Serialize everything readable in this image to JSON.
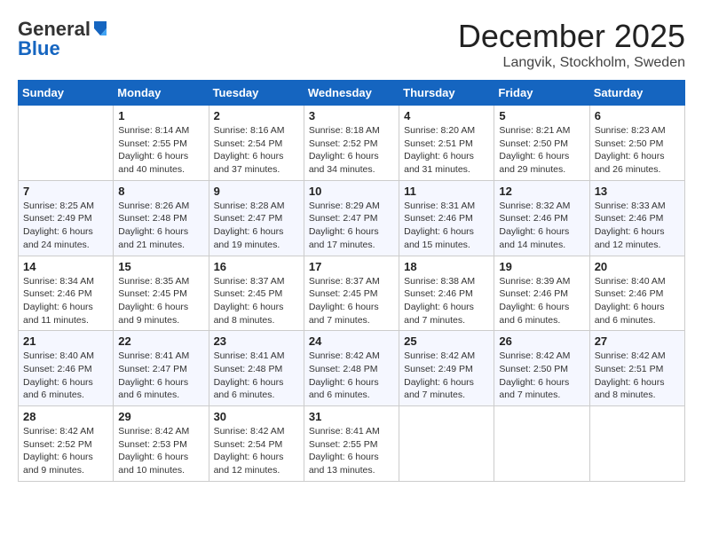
{
  "header": {
    "logo_line1": "General",
    "logo_line2": "Blue",
    "month_title": "December 2025",
    "location": "Langvik, Stockholm, Sweden"
  },
  "days_of_week": [
    "Sunday",
    "Monday",
    "Tuesday",
    "Wednesday",
    "Thursday",
    "Friday",
    "Saturday"
  ],
  "weeks": [
    [
      {
        "day": "",
        "detail": ""
      },
      {
        "day": "1",
        "detail": "Sunrise: 8:14 AM\nSunset: 2:55 PM\nDaylight: 6 hours\nand 40 minutes."
      },
      {
        "day": "2",
        "detail": "Sunrise: 8:16 AM\nSunset: 2:54 PM\nDaylight: 6 hours\nand 37 minutes."
      },
      {
        "day": "3",
        "detail": "Sunrise: 8:18 AM\nSunset: 2:52 PM\nDaylight: 6 hours\nand 34 minutes."
      },
      {
        "day": "4",
        "detail": "Sunrise: 8:20 AM\nSunset: 2:51 PM\nDaylight: 6 hours\nand 31 minutes."
      },
      {
        "day": "5",
        "detail": "Sunrise: 8:21 AM\nSunset: 2:50 PM\nDaylight: 6 hours\nand 29 minutes."
      },
      {
        "day": "6",
        "detail": "Sunrise: 8:23 AM\nSunset: 2:50 PM\nDaylight: 6 hours\nand 26 minutes."
      }
    ],
    [
      {
        "day": "7",
        "detail": "Sunrise: 8:25 AM\nSunset: 2:49 PM\nDaylight: 6 hours\nand 24 minutes."
      },
      {
        "day": "8",
        "detail": "Sunrise: 8:26 AM\nSunset: 2:48 PM\nDaylight: 6 hours\nand 21 minutes."
      },
      {
        "day": "9",
        "detail": "Sunrise: 8:28 AM\nSunset: 2:47 PM\nDaylight: 6 hours\nand 19 minutes."
      },
      {
        "day": "10",
        "detail": "Sunrise: 8:29 AM\nSunset: 2:47 PM\nDaylight: 6 hours\nand 17 minutes."
      },
      {
        "day": "11",
        "detail": "Sunrise: 8:31 AM\nSunset: 2:46 PM\nDaylight: 6 hours\nand 15 minutes."
      },
      {
        "day": "12",
        "detail": "Sunrise: 8:32 AM\nSunset: 2:46 PM\nDaylight: 6 hours\nand 14 minutes."
      },
      {
        "day": "13",
        "detail": "Sunrise: 8:33 AM\nSunset: 2:46 PM\nDaylight: 6 hours\nand 12 minutes."
      }
    ],
    [
      {
        "day": "14",
        "detail": "Sunrise: 8:34 AM\nSunset: 2:46 PM\nDaylight: 6 hours\nand 11 minutes."
      },
      {
        "day": "15",
        "detail": "Sunrise: 8:35 AM\nSunset: 2:45 PM\nDaylight: 6 hours\nand 9 minutes."
      },
      {
        "day": "16",
        "detail": "Sunrise: 8:37 AM\nSunset: 2:45 PM\nDaylight: 6 hours\nand 8 minutes."
      },
      {
        "day": "17",
        "detail": "Sunrise: 8:37 AM\nSunset: 2:45 PM\nDaylight: 6 hours\nand 7 minutes."
      },
      {
        "day": "18",
        "detail": "Sunrise: 8:38 AM\nSunset: 2:46 PM\nDaylight: 6 hours\nand 7 minutes."
      },
      {
        "day": "19",
        "detail": "Sunrise: 8:39 AM\nSunset: 2:46 PM\nDaylight: 6 hours\nand 6 minutes."
      },
      {
        "day": "20",
        "detail": "Sunrise: 8:40 AM\nSunset: 2:46 PM\nDaylight: 6 hours\nand 6 minutes."
      }
    ],
    [
      {
        "day": "21",
        "detail": "Sunrise: 8:40 AM\nSunset: 2:46 PM\nDaylight: 6 hours\nand 6 minutes."
      },
      {
        "day": "22",
        "detail": "Sunrise: 8:41 AM\nSunset: 2:47 PM\nDaylight: 6 hours\nand 6 minutes."
      },
      {
        "day": "23",
        "detail": "Sunrise: 8:41 AM\nSunset: 2:48 PM\nDaylight: 6 hours\nand 6 minutes."
      },
      {
        "day": "24",
        "detail": "Sunrise: 8:42 AM\nSunset: 2:48 PM\nDaylight: 6 hours\nand 6 minutes."
      },
      {
        "day": "25",
        "detail": "Sunrise: 8:42 AM\nSunset: 2:49 PM\nDaylight: 6 hours\nand 7 minutes."
      },
      {
        "day": "26",
        "detail": "Sunrise: 8:42 AM\nSunset: 2:50 PM\nDaylight: 6 hours\nand 7 minutes."
      },
      {
        "day": "27",
        "detail": "Sunrise: 8:42 AM\nSunset: 2:51 PM\nDaylight: 6 hours\nand 8 minutes."
      }
    ],
    [
      {
        "day": "28",
        "detail": "Sunrise: 8:42 AM\nSunset: 2:52 PM\nDaylight: 6 hours\nand 9 minutes."
      },
      {
        "day": "29",
        "detail": "Sunrise: 8:42 AM\nSunset: 2:53 PM\nDaylight: 6 hours\nand 10 minutes."
      },
      {
        "day": "30",
        "detail": "Sunrise: 8:42 AM\nSunset: 2:54 PM\nDaylight: 6 hours\nand 12 minutes."
      },
      {
        "day": "31",
        "detail": "Sunrise: 8:41 AM\nSunset: 2:55 PM\nDaylight: 6 hours\nand 13 minutes."
      },
      {
        "day": "",
        "detail": ""
      },
      {
        "day": "",
        "detail": ""
      },
      {
        "day": "",
        "detail": ""
      }
    ]
  ]
}
